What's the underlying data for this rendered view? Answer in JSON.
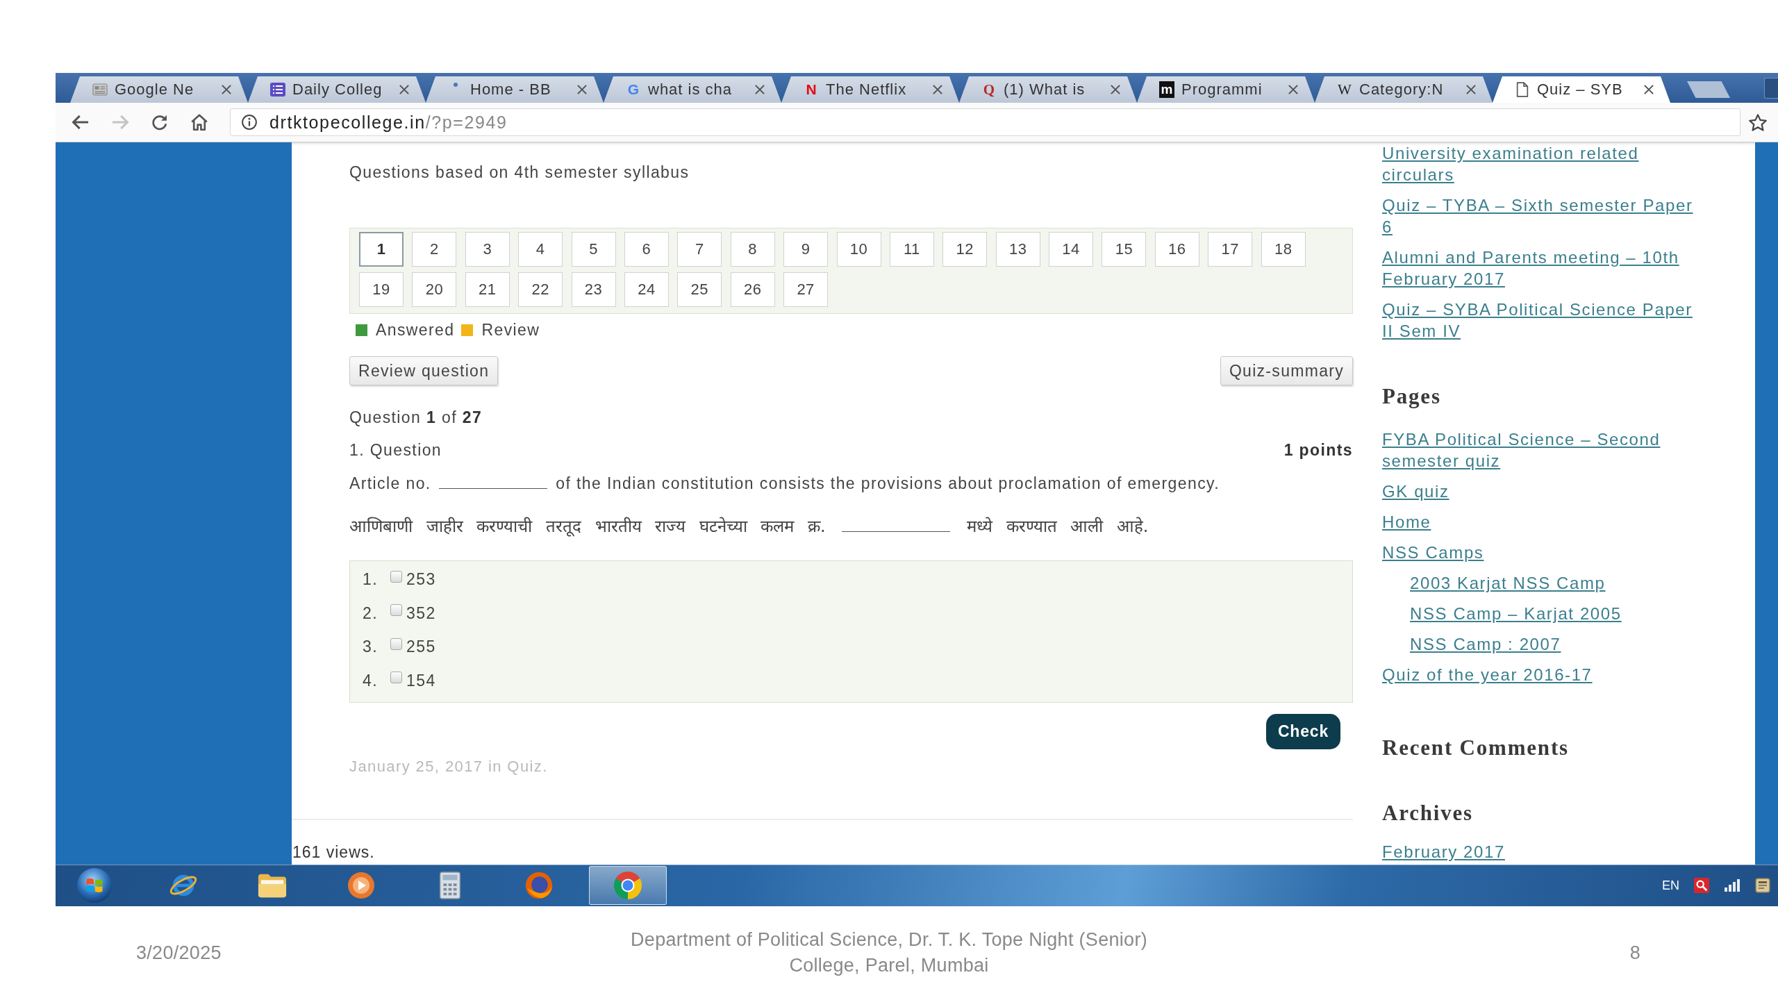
{
  "browser": {
    "tabs": [
      {
        "title": "Google Ne",
        "kind": "news",
        "selected": false
      },
      {
        "title": "Daily Colleg",
        "kind": "list",
        "selected": false
      },
      {
        "title": "Home - BB",
        "kind": "dot",
        "selected": false
      },
      {
        "title": "what is cha",
        "kind": "google",
        "glyph": "G",
        "selected": false
      },
      {
        "title": "The Netflix",
        "kind": "netflix",
        "glyph": "N",
        "selected": false
      },
      {
        "title": "(1) What is",
        "kind": "quora",
        "glyph": "Q",
        "selected": false
      },
      {
        "title": "Programmi",
        "kind": "tile",
        "glyph": "m",
        "selected": false
      },
      {
        "title": "Category:N",
        "kind": "wiki",
        "glyph": "W",
        "selected": false
      },
      {
        "title": "Quiz – SYB",
        "kind": "page",
        "selected": true
      }
    ],
    "toolbar": [
      {
        "kind": "back",
        "disabled": false
      },
      {
        "kind": "forward",
        "disabled": true
      },
      {
        "kind": "reload",
        "disabled": false
      },
      {
        "kind": "home",
        "disabled": false
      }
    ],
    "address": {
      "host": "drtktopecollege.in",
      "path": "/?p=2949"
    }
  },
  "page": {
    "intro": "Questions based on 4th semester syllabus",
    "question_nav": [
      {
        "label": "1",
        "selected": true
      },
      {
        "label": "2",
        "selected": false
      },
      {
        "label": "3",
        "selected": false
      },
      {
        "label": "4",
        "selected": false
      },
      {
        "label": "5",
        "selected": false
      },
      {
        "label": "6",
        "selected": false
      },
      {
        "label": "7",
        "selected": false
      },
      {
        "label": "8",
        "selected": false
      },
      {
        "label": "9",
        "selected": false
      },
      {
        "label": "10",
        "selected": false
      },
      {
        "label": "11",
        "selected": false
      },
      {
        "label": "12",
        "selected": false
      },
      {
        "label": "13",
        "selected": false
      },
      {
        "label": "14",
        "selected": false
      },
      {
        "label": "15",
        "selected": false
      },
      {
        "label": "16",
        "selected": false
      },
      {
        "label": "17",
        "selected": false
      },
      {
        "label": "18",
        "selected": false
      },
      {
        "label": "19",
        "selected": false
      },
      {
        "label": "20",
        "selected": false
      },
      {
        "label": "21",
        "selected": false
      },
      {
        "label": "22",
        "selected": false
      },
      {
        "label": "23",
        "selected": false
      },
      {
        "label": "24",
        "selected": false
      },
      {
        "label": "25",
        "selected": false
      },
      {
        "label": "26",
        "selected": false
      },
      {
        "label": "27",
        "selected": false
      }
    ],
    "legend": [
      {
        "label": "Answered",
        "color": "#3f9a3f"
      },
      {
        "label": "Review",
        "color": "#f2b619"
      }
    ],
    "review_button": "Review question",
    "summary_button": "Quiz-summary",
    "counter": "Question **1** of **27**",
    "question": {
      "title": "1. Question",
      "points": "1 points",
      "text_before": "Article no.",
      "text_after": "of the Indian constitution consists the provisions about proclamation of emergency.",
      "marathi_before": "आणिबाणी जाहीर करण्याची तरतूद भारतीय राज्य घटनेच्या कलम क्र.",
      "marathi_after": "मध्ये करण्यात आली आहे."
    },
    "answers": [
      {
        "number": "1.",
        "label": "253",
        "checked": false
      },
      {
        "number": "2.",
        "label": "352",
        "checked": false
      },
      {
        "number": "3.",
        "label": "255",
        "checked": false
      },
      {
        "number": "4.",
        "label": "154",
        "checked": false
      }
    ],
    "check_button": "Check",
    "meta": "January 25, 2017 in Quiz.",
    "views": "161 views."
  },
  "sidebar": {
    "recent_posts": [
      "University examination related circulars",
      "Quiz – TYBA – Sixth semester Paper 6",
      "Alumni and Parents meeting – 10th February 2017",
      "Quiz – SYBA Political Science Paper II Sem IV"
    ],
    "pages_heading": "Pages",
    "pages": [
      {
        "label": "FYBA Political Science – Second semester quiz"
      },
      {
        "label": "GK quiz"
      },
      {
        "label": "Home"
      },
      {
        "label": "NSS Camps",
        "children": [
          {
            "label": "2003 Karjat NSS Camp"
          },
          {
            "label": "NSS Camp – Karjat 2005"
          },
          {
            "label": "NSS Camp : 2007"
          }
        ]
      },
      {
        "label": "Quiz of the year 2016-17"
      }
    ],
    "comments_heading": "Recent Comments",
    "archives_heading": "Archives",
    "archives": [
      "February 2017"
    ]
  },
  "taskbar": {
    "apps": [
      {
        "kind": "start",
        "selected": false
      },
      {
        "kind": "ie",
        "selected": false
      },
      {
        "kind": "folder",
        "selected": false
      },
      {
        "kind": "media",
        "selected": false
      },
      {
        "kind": "calculator",
        "selected": false
      },
      {
        "kind": "firefox",
        "selected": false
      },
      {
        "kind": "chrome",
        "selected": true
      }
    ],
    "language": "EN"
  },
  "footer": {
    "date": "3/20/2025",
    "caption": "Department of Political Science, Dr. T. K. Tope Night (Senior) College, Parel, Mumbai",
    "page_number": "8"
  }
}
